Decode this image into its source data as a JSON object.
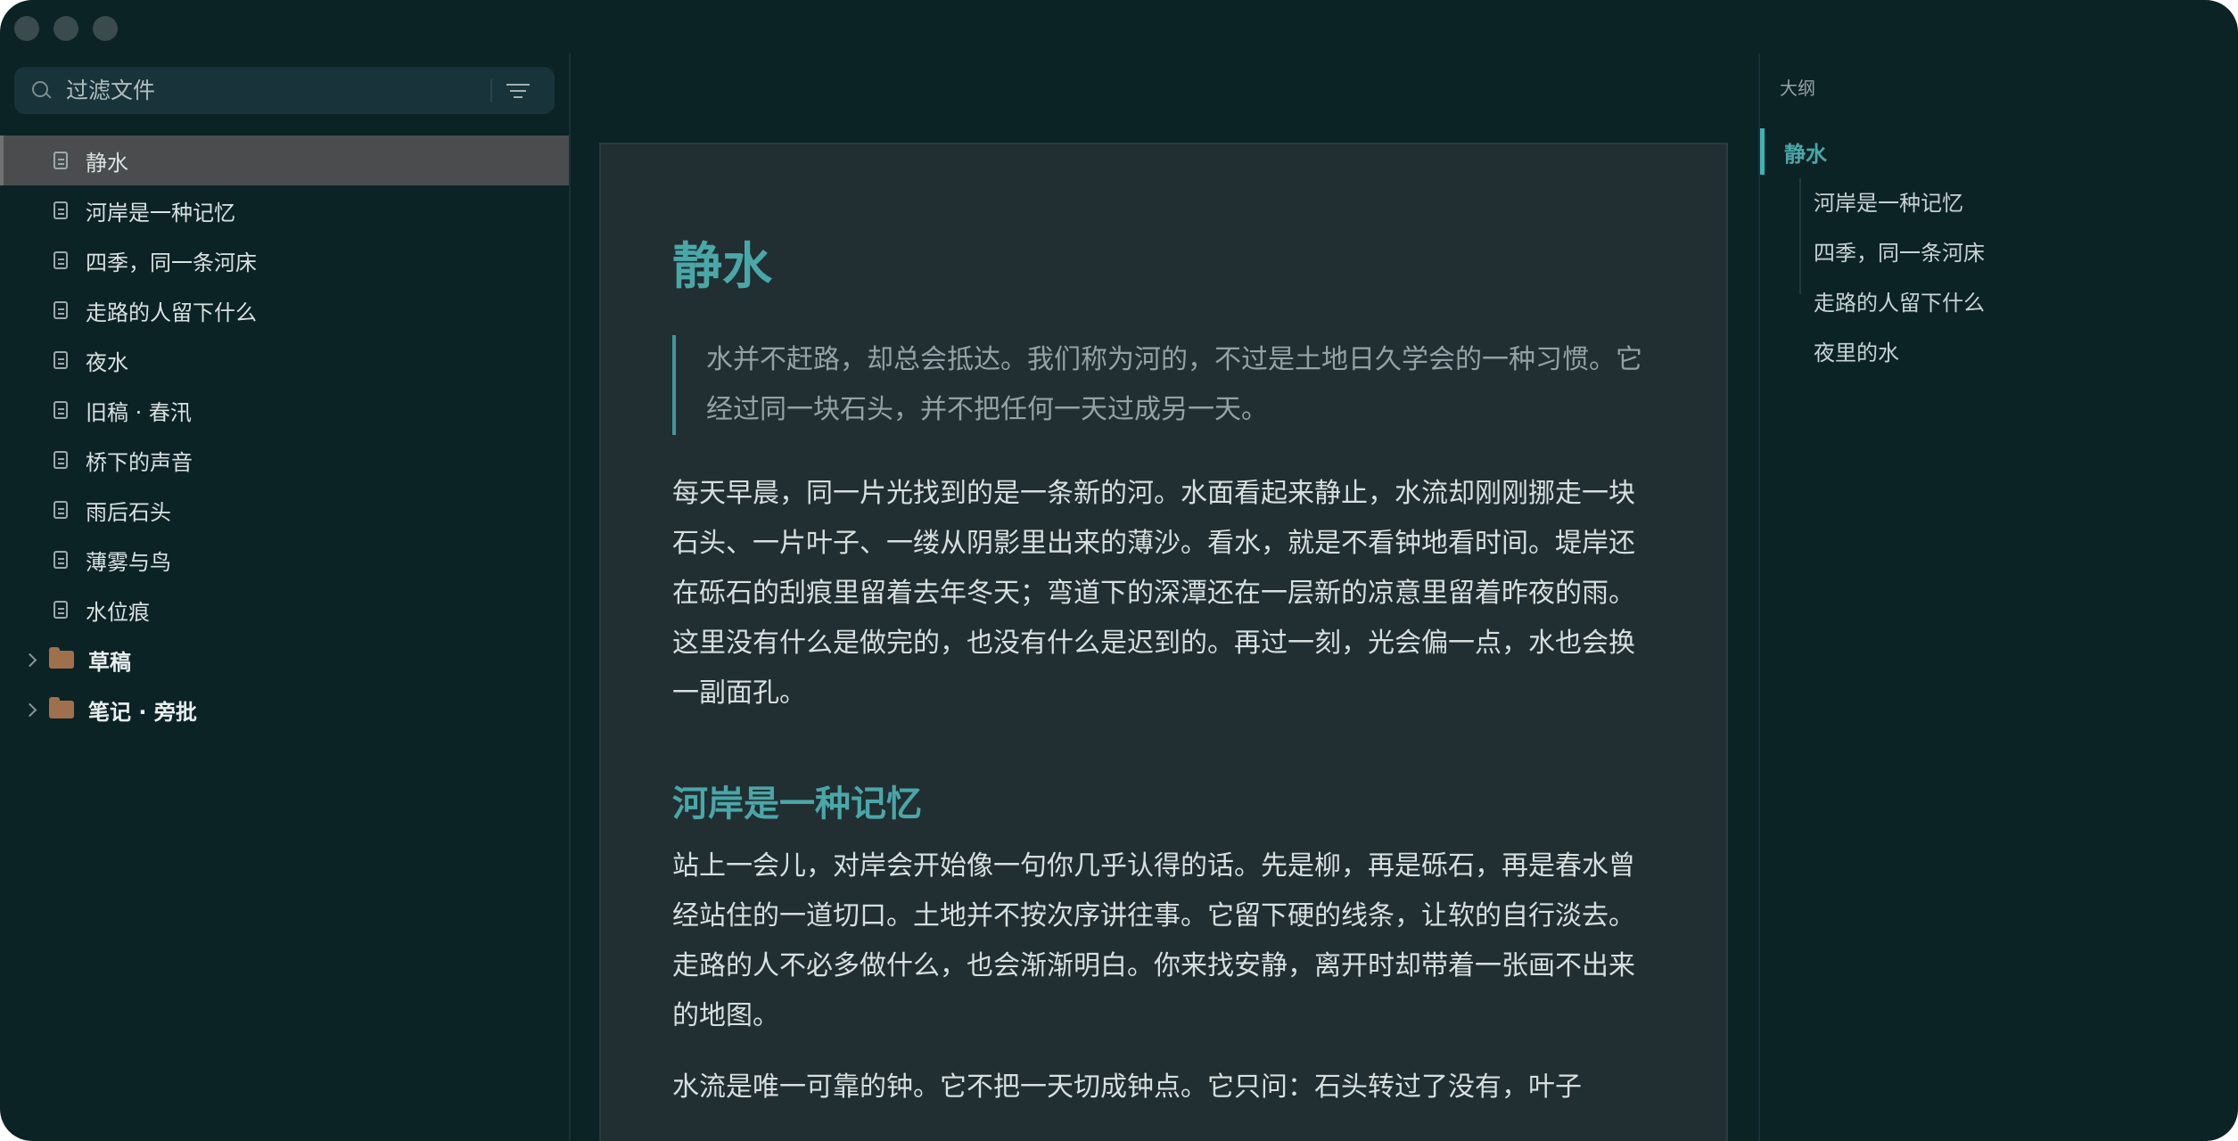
{
  "sidebar": {
    "search": {
      "placeholder": "过滤文件"
    },
    "files": [
      {
        "label": "静水",
        "active": true
      },
      {
        "label": "河岸是一种记忆"
      },
      {
        "label": "四季，同一条河床"
      },
      {
        "label": "走路的人留下什么"
      },
      {
        "label": "夜水"
      },
      {
        "label": "旧稿 · 春汛"
      },
      {
        "label": "桥下的声音"
      },
      {
        "label": "雨后石头"
      },
      {
        "label": "薄雾与鸟"
      },
      {
        "label": "水位痕"
      }
    ],
    "folders": [
      {
        "label": "草稿"
      },
      {
        "label": "笔记 · 旁批"
      }
    ]
  },
  "document": {
    "title": "静水",
    "quote": "水并不赶路，却总会抵达。我们称为河的，不过是土地日久学会的一种习惯。它经过同一块石头，并不把任何一天过成另一天。",
    "paragraph1": "每天早晨，同一片光找到的是一条新的河。水面看起来静止，水流却刚刚挪走一块石头、一片叶子、一缕从阴影里出来的薄沙。看水，就是不看钟地看时间。堤岸还在砾石的刮痕里留着去年冬天；弯道下的深潭还在一层新的凉意里留着昨夜的雨。这里没有什么是做完的，也没有什么是迟到的。再过一刻，光会偏一点，水也会换一副面孔。",
    "heading2": "河岸是一种记忆",
    "paragraph2": "站上一会儿，对岸会开始像一句你几乎认得的话。先是柳，再是砾石，再是春水曾经站住的一道切口。土地并不按次序讲往事。它留下硬的线条，让软的自行淡去。走路的人不必多做什么，也会渐渐明白。你来找安静，离开时却带着一张画不出来的地图。",
    "paragraph3": "水流是唯一可靠的钟。它不把一天切成钟点。它只问：石头转过了没有，叶子"
  },
  "outline": {
    "label": "大纲",
    "active": "静水",
    "children": [
      "河岸是一种记忆",
      "四季，同一条河床",
      "走路的人留下什么",
      "夜里的水"
    ]
  }
}
